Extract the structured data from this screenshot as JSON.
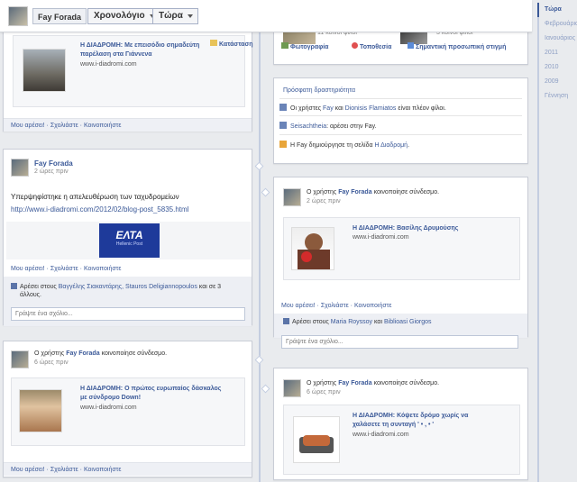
{
  "topbar": {
    "name": "Fay Forada",
    "timeline": "Χρονολόγιο",
    "now": "Τώρα"
  },
  "years": [
    "Τώρα",
    "Φεβρουάριος",
    "Ιανουάριος",
    "2011",
    "2010",
    "2009",
    "Γέννηση"
  ],
  "footer": {
    "like": "Μου αρέσει!",
    "comment": "Σχολιάστε",
    "share": "Κοινοποιήστε"
  },
  "post1": {
    "title": "Η ΔΙΑΔΡΟΜΗ: Με επεισόδιο σημαδεύτη",
    "title2": "παρέλαση στα Γιάννενα",
    "url": "www.i-diadromi.com",
    "status": "Κατάσταση"
  },
  "about": {
    "friends1": "11 κοινοί φίλοι",
    "friends2": "3 κοινοί φίλοι",
    "photo": "Φωτογραφία",
    "place": "Τοποθεσία",
    "event": "Σημαντική προσωπική στιγμή"
  },
  "activity": {
    "title": "Πρόσφατη δραστηριότητα",
    "a1_pre": "Οι χρήστες",
    "a1_u1": "Fay",
    "a1_and": "και",
    "a1_u2": "Dionisis Flamiatos",
    "a1_post": "είναι πλέον φίλοι.",
    "a2_u": "Seisachtheia",
    "a2_post": ": αρέσει στην Fay.",
    "a3_pre": "Η Fay δημιούργησε τη σελίδα",
    "a3_u": "Η Διαδρομή",
    "a3_post": "."
  },
  "post2": {
    "name": "Fay Forada",
    "time": "2 ώρες πριν",
    "text": "Υπερψηφίστηκε η απελευθέρωση των ταχυδρομείων",
    "link": "http://www.i-diadromi.com/2012/02/blog-post_5835.html",
    "logo": "ΕΛΤΑ",
    "logo_sub": "Hellenic Post",
    "likes_pre": "Αρέσει στους",
    "likes_names": "Βαγγέλης Σιακαντάρης, Stauros Deligiannopoulos",
    "likes_post": "και σε 3",
    "likes_post2": "άλλους.",
    "comment_ph": "Γράψτε ένα σχόλιο..."
  },
  "post3": {
    "pre": "Ο χρήστης",
    "name": "Fay Forada",
    "post": "κοινοποίησε σύνδεσμο.",
    "time": "2 ώρες πριν",
    "title": "Η ΔΙΑΔΡΟΜΗ: Βασίλης Δρυμούσης",
    "url": "www.i-diadromi.com",
    "likes_pre": "Αρέσει στους",
    "likes_n1": "Maria Royssoy",
    "likes_and": "και",
    "likes_n2": "Biblioasi Giorgos",
    "comment_ph": "Γράψτε ένα σχόλιο..."
  },
  "post4": {
    "pre": "Ο χρήστης",
    "name": "Fay Forada",
    "post": "κοινοποίησε σύνδεσμο.",
    "time": "6 ώρες πριν",
    "title": "Η ΔΙΑΔΡΟΜΗ: Ο πρώτος ευρωπαίος δάσκαλος",
    "title2": "με σύνδρομο Down!",
    "url": "www.i-diadromi.com"
  },
  "post5": {
    "pre": "Ο χρήστης",
    "name": "Fay Forada",
    "post": "κοινοποίησε σύνδεσμο.",
    "time": "6 ώρες πριν",
    "title": "Η ΔΙΑΔΡΟΜΗ: Κόψετε δρόμο χωρίς να",
    "title2": "χαλάσετε τη συνταγή ' • , • '",
    "url": "www.i-diadromi.com"
  }
}
